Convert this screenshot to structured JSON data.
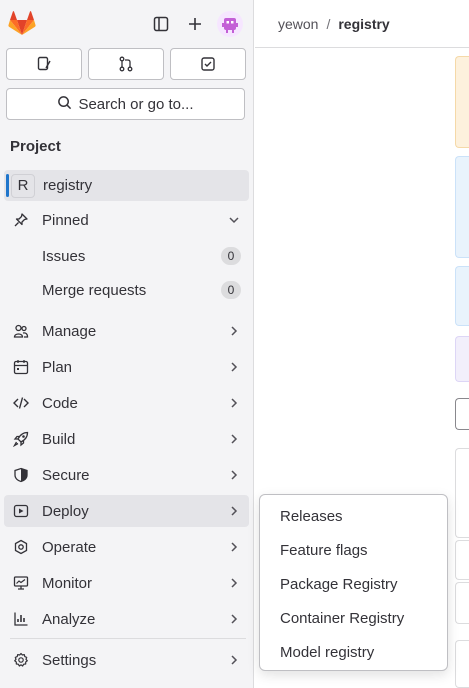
{
  "colors": {
    "accent": "#1f75cb",
    "sidebar_bg": "#f4f4f6",
    "logo_orange": "#e24329"
  },
  "topbar": {
    "logo_icon": "gitlab-logo-icon",
    "sidebar_toggle_icon": "sidebar-toggle-icon",
    "new_icon": "plus-icon",
    "avatar_icon": "user-avatar-icon"
  },
  "quick_actions": [
    {
      "icon": "issues-icon"
    },
    {
      "icon": "merge-request-icon"
    },
    {
      "icon": "todo-icon"
    }
  ],
  "search": {
    "label": "Search or go to..."
  },
  "section_title": "Project",
  "project": {
    "letter": "R",
    "name": "registry"
  },
  "pinned": {
    "label": "Pinned",
    "items": [
      {
        "label": "Issues",
        "count": "0"
      },
      {
        "label": "Merge requests",
        "count": "0"
      }
    ]
  },
  "nav": [
    {
      "label": "Manage",
      "icon": "users-icon"
    },
    {
      "label": "Plan",
      "icon": "calendar-icon"
    },
    {
      "label": "Code",
      "icon": "code-icon"
    },
    {
      "label": "Build",
      "icon": "rocket-icon"
    },
    {
      "label": "Secure",
      "icon": "shield-icon"
    },
    {
      "label": "Deploy",
      "icon": "deployments-icon"
    },
    {
      "label": "Operate",
      "icon": "cloud-gear-icon"
    },
    {
      "label": "Monitor",
      "icon": "monitor-icon"
    },
    {
      "label": "Analyze",
      "icon": "chart-icon"
    }
  ],
  "settings": {
    "label": "Settings",
    "icon": "gear-icon"
  },
  "breadcrumb": {
    "group": "yewon",
    "separator": "/",
    "project": "registry"
  },
  "flyout": {
    "items": [
      "Releases",
      "Feature flags",
      "Package Registry",
      "Container Registry",
      "Model registry"
    ]
  }
}
